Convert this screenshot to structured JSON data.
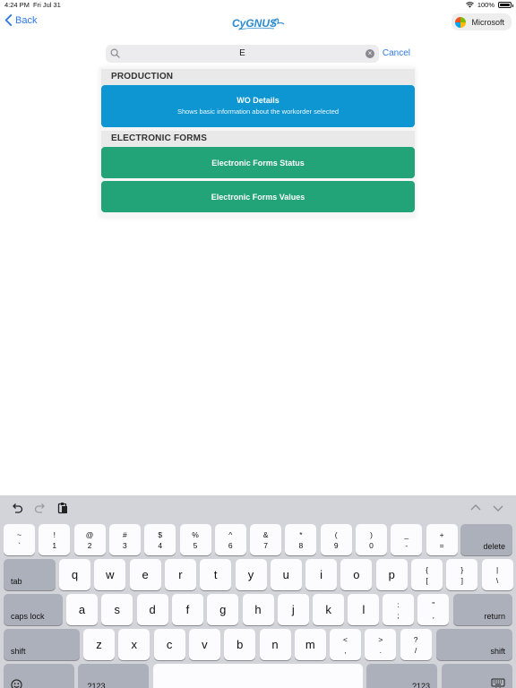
{
  "status_bar": {
    "time": "4:24 PM",
    "date": "Fri Jul 31",
    "battery": "100%",
    "battery_level": 1.0
  },
  "nav": {
    "back_label": "Back",
    "logo_text": "CyGNUS",
    "account_label": "Microsoft"
  },
  "search": {
    "value": "E",
    "cancel_label": "Cancel"
  },
  "sections": [
    {
      "title": "PRODUCTION",
      "items": [
        {
          "title": "WO Details",
          "subtitle": "Shows basic information about the workorder selected",
          "color": "#0d96d2"
        }
      ]
    },
    {
      "title": "ELECTRONIC FORMS",
      "items": [
        {
          "title": "Electronic Forms Status",
          "color": "#23a378"
        },
        {
          "title": "Electronic Forms Values",
          "color": "#23a378"
        }
      ]
    }
  ],
  "keyboard": {
    "toolbar_icons": [
      "undo-icon",
      "redo-icon",
      "paste-icon",
      "chevron-up-icon",
      "chevron-down-icon"
    ],
    "number_row": [
      [
        "~",
        "`"
      ],
      [
        "!",
        "1"
      ],
      [
        "@",
        "2"
      ],
      [
        "#",
        "3"
      ],
      [
        "$",
        "4"
      ],
      [
        "%",
        "5"
      ],
      [
        "^",
        "6"
      ],
      [
        "&",
        "7"
      ],
      [
        "*",
        "8"
      ],
      [
        "(",
        "9"
      ],
      [
        ")",
        "0"
      ],
      [
        "_",
        "-"
      ],
      [
        "+",
        "="
      ]
    ],
    "delete_label": "delete",
    "tab_label": "tab",
    "row_q": [
      "q",
      "w",
      "e",
      "r",
      "t",
      "y",
      "u",
      "i",
      "o",
      "p"
    ],
    "row_q_extra": [
      [
        "{",
        "["
      ],
      [
        "}",
        "]"
      ],
      [
        "|",
        "\\"
      ]
    ],
    "caps_label": "caps lock",
    "row_a": [
      "a",
      "s",
      "d",
      "f",
      "g",
      "h",
      "j",
      "k",
      "l"
    ],
    "row_a_extra": [
      [
        ":",
        ";"
      ],
      [
        "\"",
        ","
      ]
    ],
    "return_label": "return",
    "shift_label": "shift",
    "row_z": [
      "z",
      "x",
      "c",
      "v",
      "b",
      "n",
      "m"
    ],
    "row_z_extra": [
      [
        "<",
        ","
      ],
      [
        ">",
        "."
      ],
      [
        "?",
        "/"
      ]
    ],
    "numbers_label": ".?123",
    "emoji_icon": "emoji-icon",
    "dismiss_icon": "keyboard-dismiss-icon"
  },
  "colors": {
    "accent": "#2f7ae5",
    "tile_blue": "#0d96d2",
    "tile_green": "#23a378"
  }
}
